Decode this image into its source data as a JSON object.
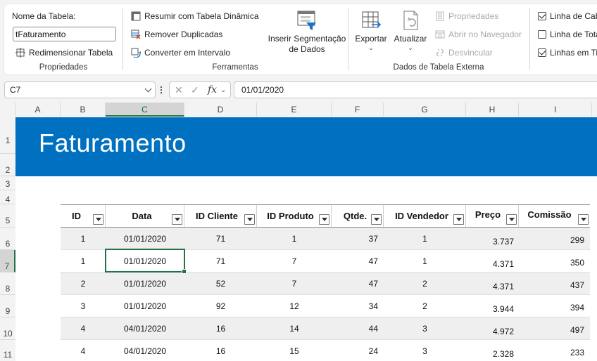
{
  "ribbon": {
    "properties": {
      "table_name_label": "Nome da Tabela:",
      "table_name_value": "tFaturamento",
      "resize_table": "Redimensionar Tabela",
      "group_label": "Propriedades"
    },
    "tools": {
      "pivot": "Resumir com Tabela Dinâmica",
      "remove_duplicates": "Remover Duplicadas",
      "convert_range": "Converter em Intervalo",
      "slicer_line1": "Inserir Segmentação",
      "slicer_line2": "de Dados",
      "group_label": "Ferramentas"
    },
    "external": {
      "export": "Exportar",
      "refresh": "Atualizar",
      "properties": "Propriedades",
      "open_browser": "Abrir no Navegador",
      "unlink": "Desvincular",
      "group_label": "Dados de Tabela Externa"
    },
    "style_options": {
      "header_row": "Linha de Cab",
      "total_row": "Linha de Tota",
      "banded_rows": "Linhas em Ti",
      "header_row_checked": true,
      "total_row_checked": false,
      "banded_rows_checked": true
    }
  },
  "formula_bar": {
    "name_box": "C7",
    "fx": "fx",
    "formula": "01/01/2020"
  },
  "columns": [
    "A",
    "B",
    "C",
    "D",
    "E",
    "F",
    "G",
    "H",
    "I"
  ],
  "rows": [
    "1",
    "2",
    "3",
    "4",
    "5",
    "6",
    "7",
    "8",
    "9",
    "10",
    "11"
  ],
  "selected_column": "C",
  "selected_row": "7",
  "sheet": {
    "title": "Faturamento",
    "banner_color": "#0070c0",
    "table": {
      "headers": [
        "ID",
        "Data",
        "ID Cliente",
        "ID Produto",
        "Qtde.",
        "ID Vendedor",
        "Preço",
        "Comissão"
      ],
      "rows": [
        [
          "1",
          "01/01/2020",
          "71",
          "1",
          "37",
          "1",
          "3.737",
          "299"
        ],
        [
          "1",
          "01/01/2020",
          "71",
          "7",
          "47",
          "1",
          "4.371",
          "350"
        ],
        [
          "2",
          "01/01/2020",
          "52",
          "7",
          "47",
          "2",
          "4.371",
          "437"
        ],
        [
          "3",
          "01/01/2020",
          "92",
          "12",
          "34",
          "2",
          "3.944",
          "394"
        ],
        [
          "4",
          "04/01/2020",
          "16",
          "14",
          "44",
          "3",
          "4.972",
          "497"
        ],
        [
          "4",
          "04/01/2020",
          "16",
          "15",
          "24",
          "3",
          "2.328",
          "233"
        ]
      ]
    }
  },
  "accent_color": "#217346"
}
